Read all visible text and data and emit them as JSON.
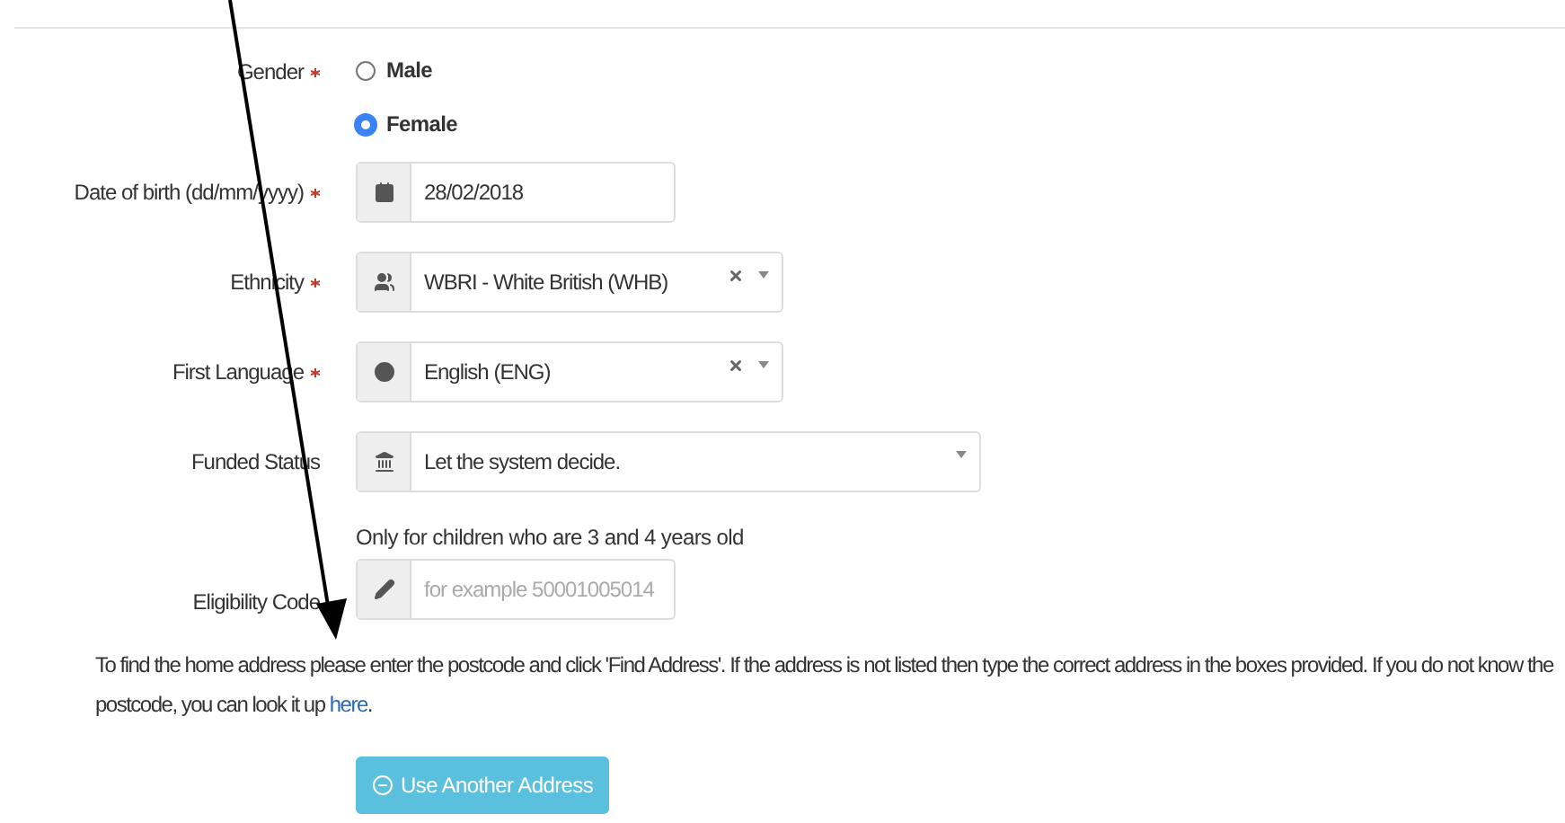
{
  "fields": [
    {
      "kind": "radio",
      "label": "Gender",
      "required": true,
      "options": [
        {
          "label": "Male",
          "selected": false
        },
        {
          "label": "Female",
          "selected": true
        }
      ]
    },
    {
      "kind": "input",
      "label": "Date of birth (dd/mm/yyyy)",
      "required": true,
      "value": "28/02/2018"
    },
    {
      "kind": "select",
      "label": "Ethnicity",
      "required": true,
      "value": "WBRI - White British (WHB)",
      "clearable": true
    },
    {
      "kind": "select",
      "label": "First Language",
      "required": true,
      "value": "English (ENG)",
      "clearable": true
    },
    {
      "kind": "select",
      "label": "Funded Status",
      "required": false,
      "value": "Let the system decide.",
      "clearable": false
    },
    {
      "kind": "input",
      "label": "Eligibility Code",
      "required": false,
      "help": "Only for children who are 3 and 4 years old",
      "placeholder": "for example 50001005014"
    }
  ],
  "address_note": {
    "text": "To find the home address please enter the postcode and click 'Find Address'. If the address is not listed then type the correct address in the boxes provided. If you do not know the postcode, you can look it up",
    "link": "here",
    "end": "."
  },
  "button": {
    "label": "Use Another Address"
  }
}
